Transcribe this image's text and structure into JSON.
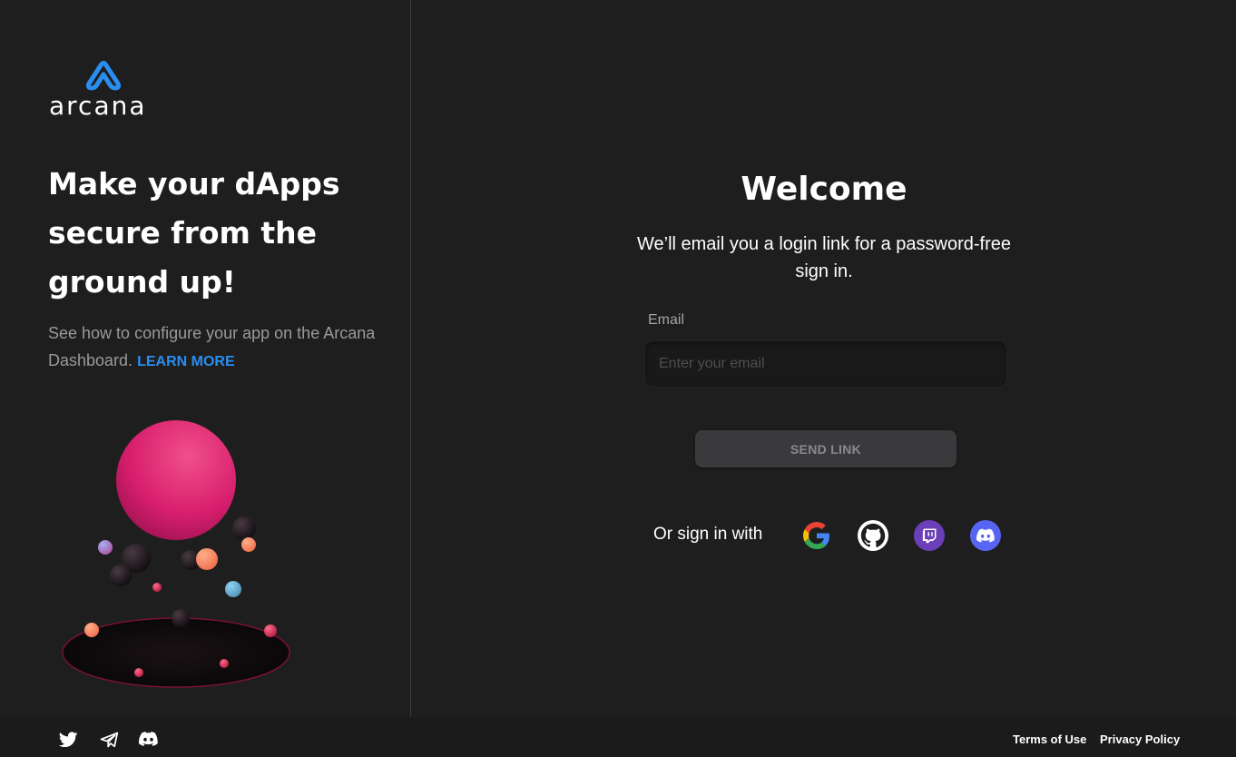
{
  "brand": {
    "name": "arcana",
    "accent": "#2a8ef0"
  },
  "hero": {
    "title": "Make your dApps secure from the ground up!",
    "subtitle": "See how to configure your app on the Arcana Dashboard.",
    "learn_more": "LEARN MORE"
  },
  "login": {
    "title": "Welcome",
    "subtitle": "We’ll email you a login link for a password-free sign in.",
    "email_label": "Email",
    "email_value": "",
    "email_placeholder": "Enter your email",
    "send_label": "SEND LINK",
    "or_sign_in": "Or sign in with",
    "providers": [
      "google-icon",
      "github-icon",
      "twitch-icon",
      "discord-icon"
    ]
  },
  "footer": {
    "social_icons": [
      "twitter-icon",
      "telegram-icon",
      "discord-icon"
    ],
    "terms": "Terms of Use",
    "privacy": "Privacy Policy"
  }
}
